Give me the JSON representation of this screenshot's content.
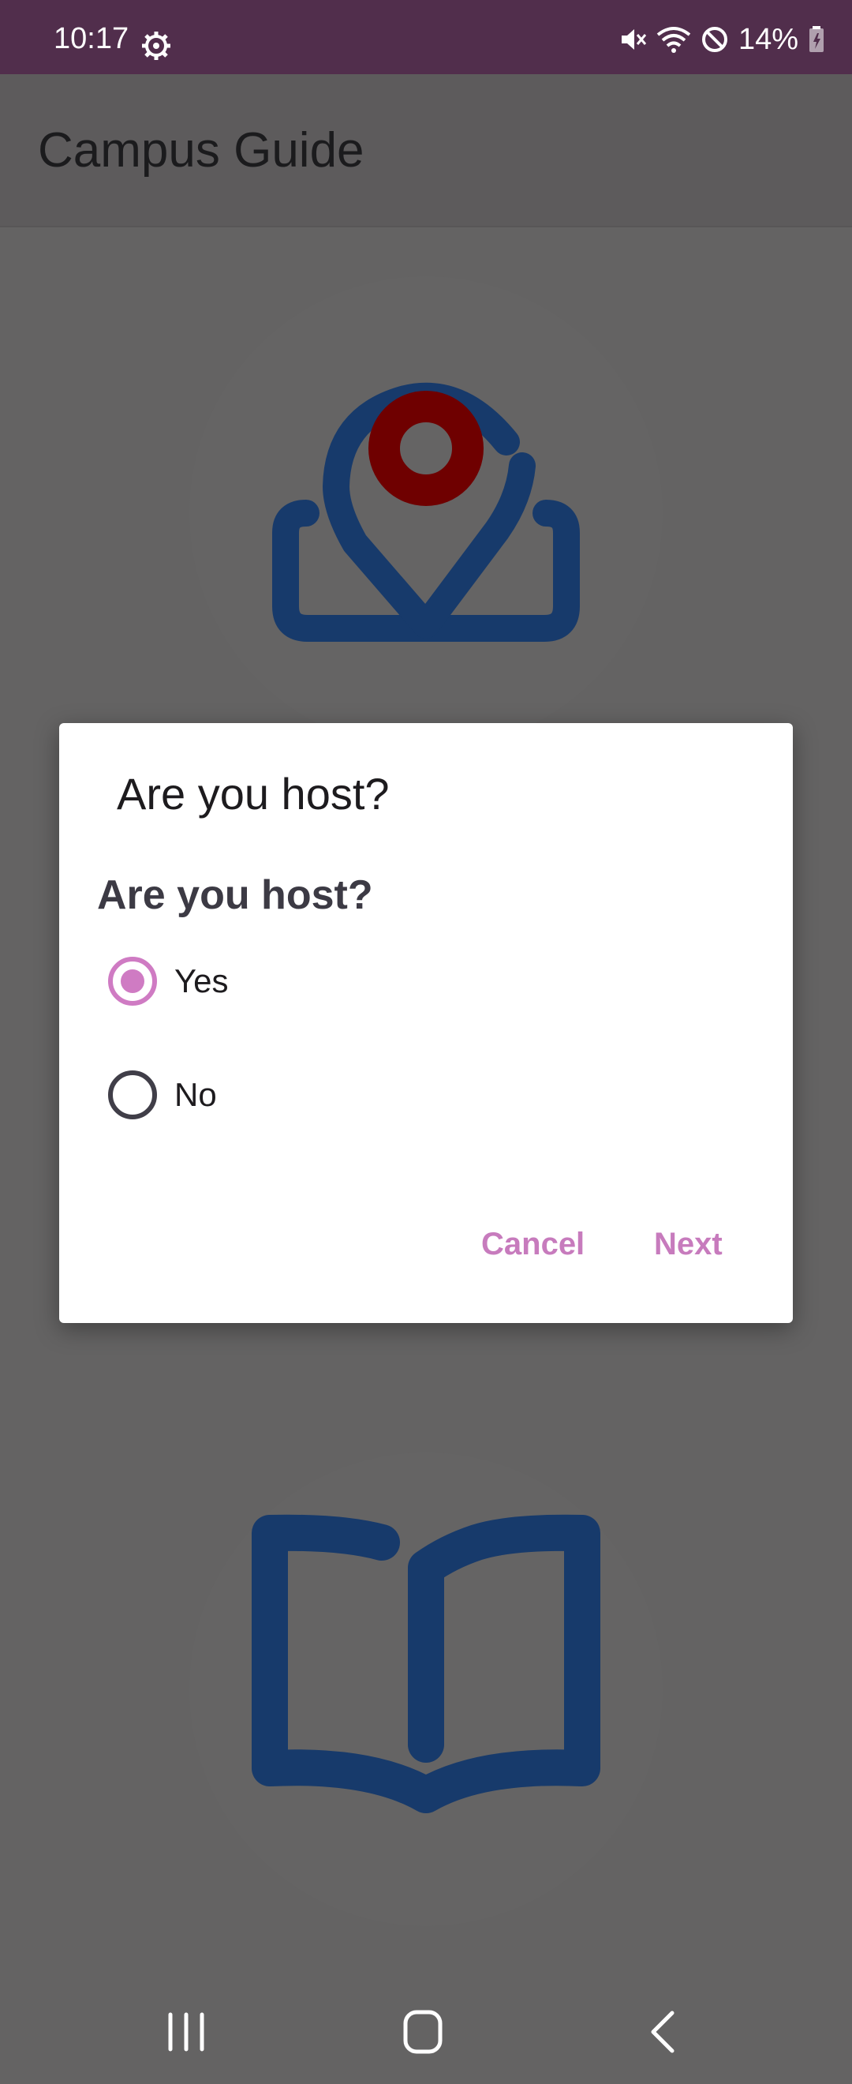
{
  "status_bar": {
    "time": "10:17",
    "battery": "14%",
    "icons": [
      "settings-gear-icon",
      "mute-icon",
      "wifi-icon",
      "do-not-disturb-icon",
      "battery-charging-icon"
    ]
  },
  "app_bar": {
    "title": "Campus Guide"
  },
  "illustrations": {
    "top": "map-pin-icon",
    "bottom": "open-book-icon",
    "colors": {
      "blue": "#173a6b",
      "red": "#6f0000"
    }
  },
  "dialog": {
    "title": "Are you host?",
    "question": "Are you host?",
    "options": [
      {
        "label": "Yes",
        "selected": true
      },
      {
        "label": "No",
        "selected": false
      }
    ],
    "cancel_label": "Cancel",
    "next_label": "Next",
    "accent_color": "#cf7bc3"
  },
  "nav_bar": {
    "buttons": [
      "recent-apps-icon",
      "home-icon",
      "back-icon"
    ]
  }
}
